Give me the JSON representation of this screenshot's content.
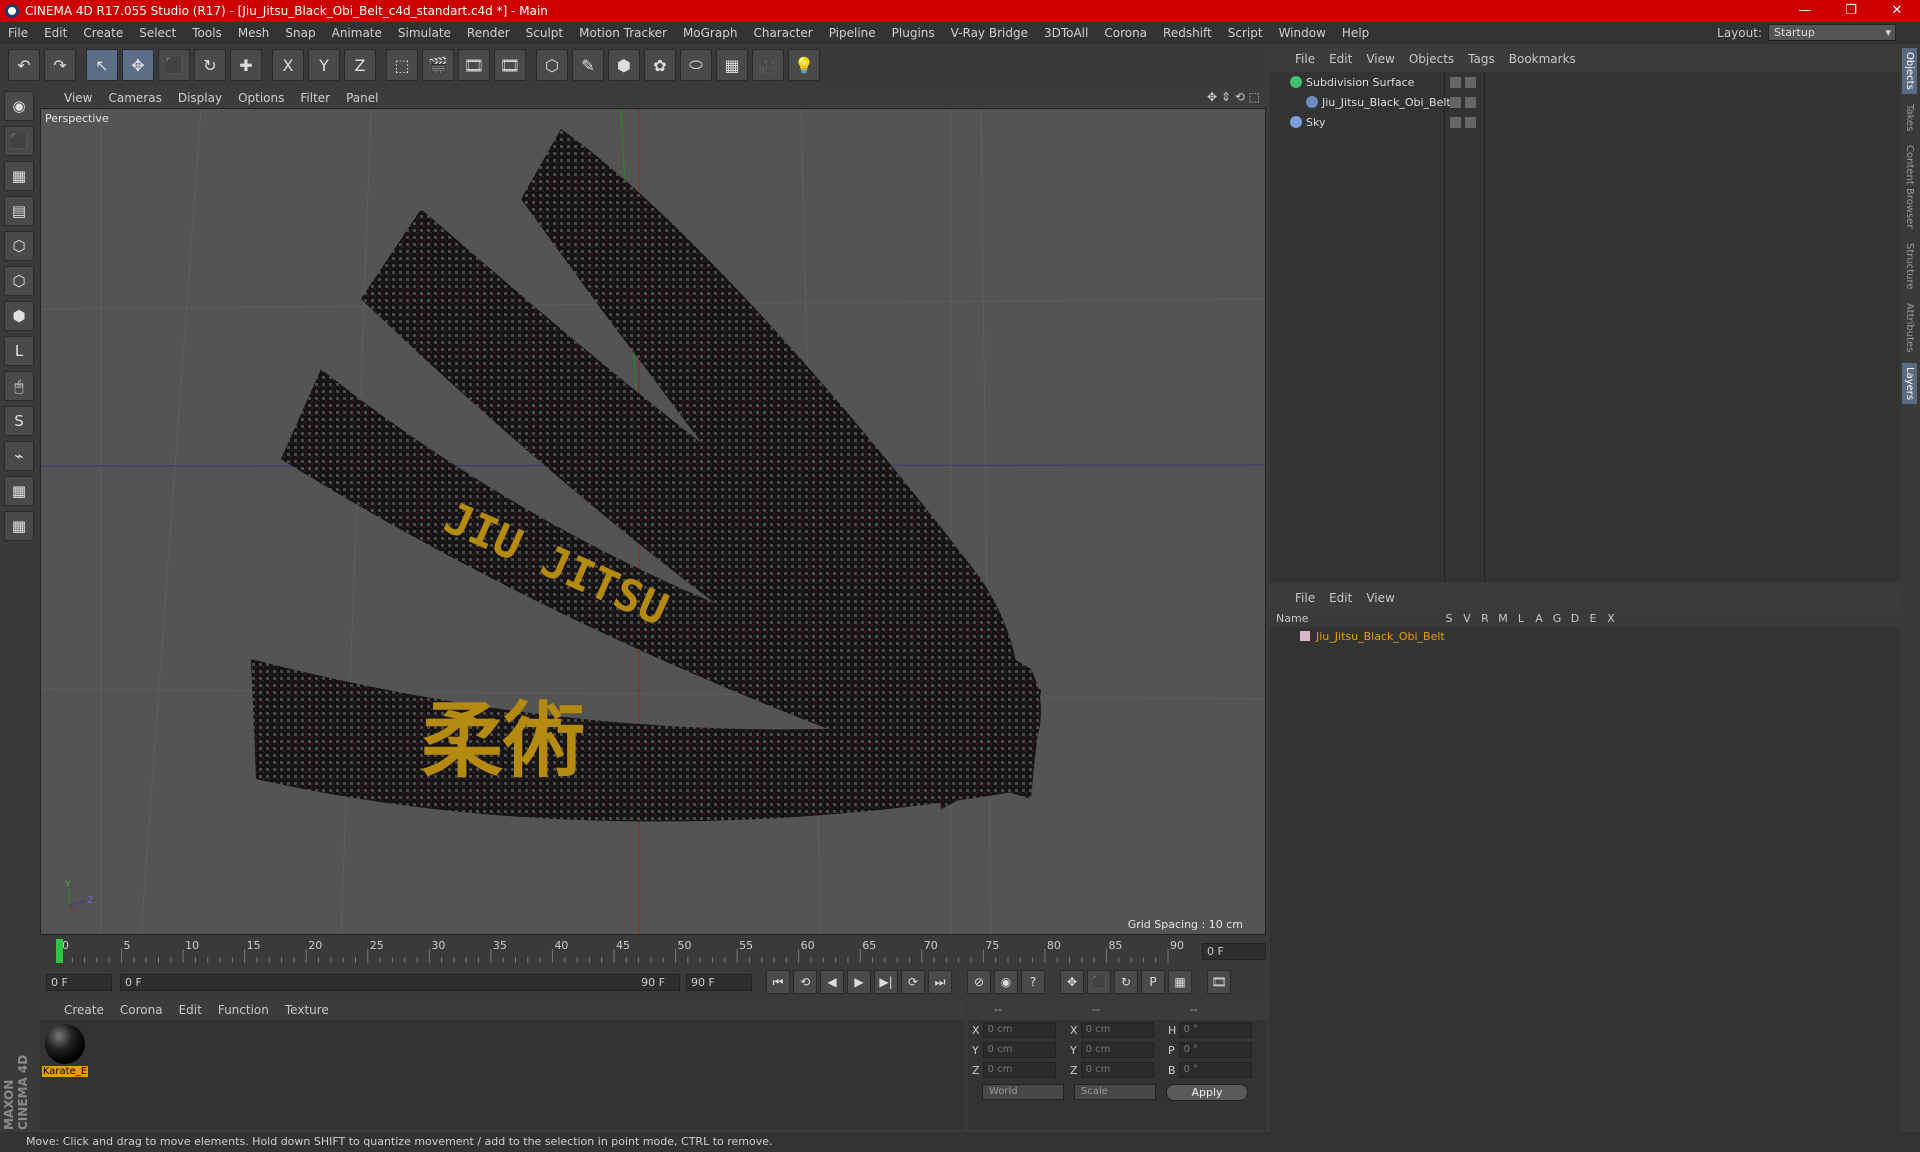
{
  "window": {
    "title": "CINEMA 4D R17.055 Studio (R17) - [Jiu_Jitsu_Black_Obi_Belt_c4d_standart.c4d *] - Main",
    "minimize": "—",
    "restore": "❐",
    "close": "✕"
  },
  "menu": [
    "File",
    "Edit",
    "Create",
    "Select",
    "Tools",
    "Mesh",
    "Snap",
    "Animate",
    "Simulate",
    "Render",
    "Sculpt",
    "Motion Tracker",
    "MoGraph",
    "Character",
    "Pipeline",
    "Plugins",
    "V-Ray Bridge",
    "3DToAll",
    "Corona",
    "Redshift",
    "Script",
    "Window",
    "Help"
  ],
  "layout": {
    "label": "Layout:",
    "value": "Startup"
  },
  "toolbar": [
    "↶",
    "↷",
    "↖",
    "✥",
    "⬛",
    "↻",
    "✚",
    "X",
    "Y",
    "Z",
    "⬚",
    "🎬",
    "🎞",
    "🎞",
    "⬡",
    "✎",
    "⬢",
    "✿",
    "⬭",
    "▦",
    "🎥",
    "💡"
  ],
  "left_tools": [
    "◉",
    "⬛",
    "▦",
    "▤",
    "⬡",
    "⬡",
    "⬢",
    "L",
    "🖱",
    "S",
    "⌁",
    "▦",
    "▦"
  ],
  "brand": "MAXON CINEMA 4D",
  "viewport": {
    "menu": [
      "View",
      "Cameras",
      "Display",
      "Options",
      "Filter",
      "Panel"
    ],
    "navicons": "✥ ⇕ ⟲ ⬚",
    "label": "Perspective",
    "grid_spacing": "Grid Spacing : 10 cm",
    "axis_y": "Y",
    "axis_z": "Z"
  },
  "timeline": {
    "ticks": [
      "0",
      "5",
      "10",
      "15",
      "20",
      "25",
      "30",
      "35",
      "40",
      "45",
      "50",
      "55",
      "60",
      "65",
      "70",
      "75",
      "80",
      "85",
      "90"
    ],
    "current": "0 F"
  },
  "transport": {
    "start": "0 F",
    "range_start": "0 F",
    "range_end": "90 F",
    "end": "90 F",
    "buttons": [
      "⏮",
      "⟲",
      "◀",
      "▶",
      "▶|",
      "⟳",
      "⏭",
      "⊘",
      "◉",
      "?",
      "✥",
      "⬛",
      "↻",
      "P",
      "▦",
      "🎞"
    ]
  },
  "materials": {
    "menu": [
      "Create",
      "Corona",
      "Edit",
      "Function",
      "Texture"
    ],
    "items": [
      {
        "name": "Karate_E"
      }
    ]
  },
  "coords": {
    "headers": [
      "--",
      "--",
      "--"
    ],
    "rows": [
      {
        "a": "X",
        "v1": "0 cm",
        "b": "X",
        "v2": "0 cm",
        "c": "H",
        "v3": "0 °"
      },
      {
        "a": "Y",
        "v1": "0 cm",
        "b": "Y",
        "v2": "0 cm",
        "c": "P",
        "v3": "0 °"
      },
      {
        "a": "Z",
        "v1": "0 cm",
        "b": "Z",
        "v2": "0 cm",
        "c": "B",
        "v3": "0 °"
      }
    ],
    "world": "World",
    "scale": "Scale",
    "apply": "Apply"
  },
  "objects": {
    "menu": [
      "File",
      "Edit",
      "View",
      "Objects",
      "Tags",
      "Bookmarks"
    ],
    "items": [
      {
        "name": "Subdivision Surface",
        "color": "#40c070"
      },
      {
        "name": "Jiu_Jitsu_Black_Obi_Belt",
        "color": "#6a8cc0"
      },
      {
        "name": "Sky",
        "color": "#7aa0d8"
      }
    ]
  },
  "layers": {
    "menu": [
      "File",
      "Edit",
      "View"
    ],
    "headers": [
      "Name",
      "S",
      "V",
      "R",
      "M",
      "L",
      "A",
      "G",
      "D",
      "E",
      "X"
    ],
    "items": [
      {
        "name": "Jiu_Jitsu_Black_Obi_Belt"
      }
    ]
  },
  "side_tabs": [
    "Objects",
    "Takes",
    "Content Browser",
    "Structure",
    "Attributes",
    "Layers"
  ],
  "status": "Move: Click and drag to move elements. Hold down SHIFT to quantize movement / add to the selection in point mode, CTRL to remove."
}
